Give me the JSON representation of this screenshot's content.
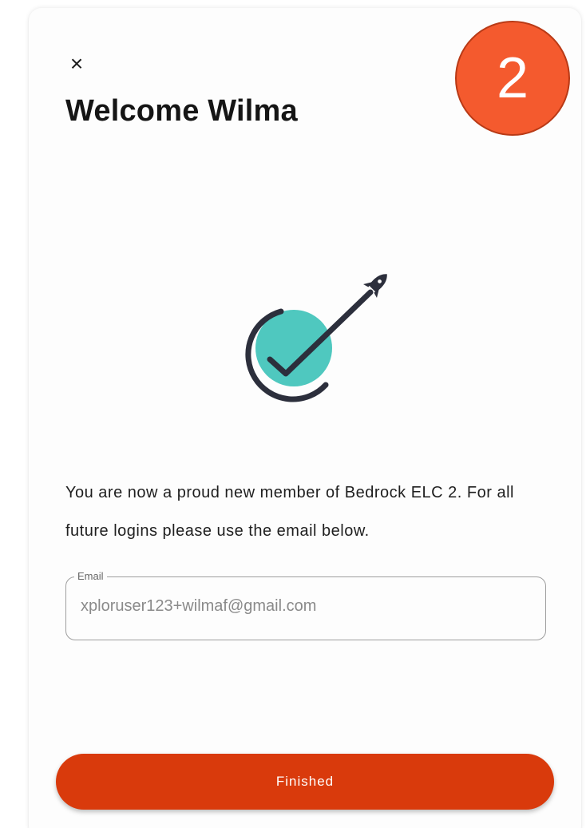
{
  "dialog": {
    "close_glyph": "×",
    "title": "Welcome Wilma",
    "message": "You are now a proud new member of Bedrock ELC 2. For all future logins please use the email below.",
    "illustration_icon": "rocket-check-icon"
  },
  "step_badge": {
    "label": "2"
  },
  "email": {
    "label": "Email",
    "value": "xploruser123+wilmaf@gmail.com"
  },
  "actions": {
    "finished_label": "Finished"
  },
  "colors": {
    "accent": "#d93a0c",
    "badge": "#f45a2e",
    "teal": "#4fc8bf",
    "ink": "#2c2f3c"
  }
}
